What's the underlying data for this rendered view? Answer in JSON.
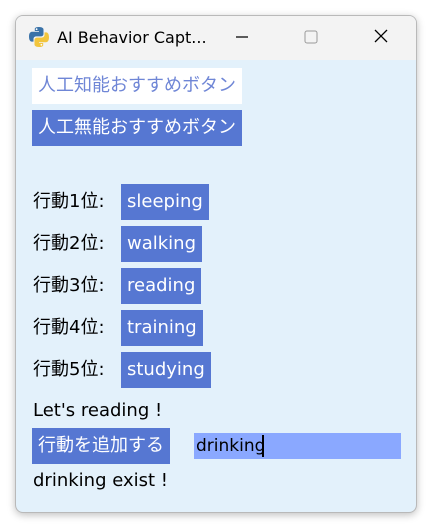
{
  "window": {
    "title": "AI Behavior Capt...",
    "icon": "python-icon",
    "controls": {
      "minimize_icon": "minimize-icon",
      "maximize_icon": "maximize-icon",
      "close_icon": "close-icon"
    }
  },
  "buttons": {
    "ai_recommend": "人工知能おすすめボタン",
    "non_ai_recommend": "人工無能おすすめボタン",
    "add_action": "行動を追加する"
  },
  "rankings": [
    {
      "label": "行動1位:",
      "action": "sleeping"
    },
    {
      "label": "行動2位:",
      "action": "walking"
    },
    {
      "label": "行動3位:",
      "action": "reading"
    },
    {
      "label": "行動4位:",
      "action": "training"
    },
    {
      "label": "行動5位:",
      "action": "studying"
    }
  ],
  "messages": {
    "suggestion": "Let's reading !",
    "add_result": "drinking exist !"
  },
  "input": {
    "value": "drinking"
  },
  "colors": {
    "window_bg": "#e3f1fb",
    "button_blue": "#5677d2",
    "input_bg": "#8aa8ff",
    "titlebar_bg": "#f3f3f3"
  }
}
